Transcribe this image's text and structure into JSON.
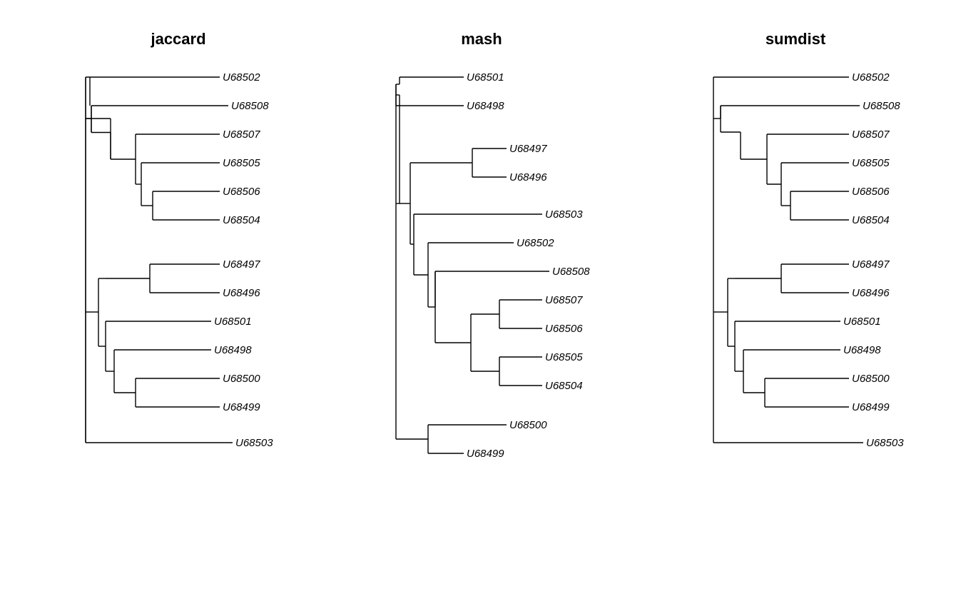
{
  "chart_data": [
    {
      "type": "dendrogram",
      "title": "jaccard",
      "tips": [
        "U68502",
        "U68508",
        "U68507",
        "U68505",
        "U68506",
        "U68504",
        "U68497",
        "U68496",
        "U68501",
        "U68498",
        "U68500",
        "U68499",
        "U68503"
      ],
      "clusters": [
        [
          "U68502"
        ],
        [
          "U68508",
          "U68507",
          "U68505",
          "U68506",
          "U68504"
        ],
        [
          "U68497",
          "U68496",
          "U68501",
          "U68498",
          "U68500",
          "U68499"
        ],
        [
          "U68503"
        ]
      ]
    },
    {
      "type": "dendrogram",
      "title": "mash",
      "tips": [
        "U68501",
        "U68498",
        "U68497",
        "U68496",
        "U68503",
        "U68502",
        "U68508",
        "U68507",
        "U68506",
        "U68505",
        "U68504",
        "U68500",
        "U68499"
      ],
      "clusters": [
        [
          "U68501",
          "U68498"
        ],
        [
          "U68497",
          "U68496"
        ],
        [
          "U68503",
          "U68502",
          "U68508",
          "U68507",
          "U68506",
          "U68505",
          "U68504"
        ],
        [
          "U68500",
          "U68499"
        ]
      ]
    },
    {
      "type": "dendrogram",
      "title": "sumdist",
      "tips": [
        "U68502",
        "U68508",
        "U68507",
        "U68505",
        "U68506",
        "U68504",
        "U68497",
        "U68496",
        "U68501",
        "U68498",
        "U68500",
        "U68499",
        "U68503"
      ],
      "clusters": [
        [
          "U68502"
        ],
        [
          "U68508",
          "U68507",
          "U68505",
          "U68506",
          "U68504"
        ],
        [
          "U68497",
          "U68496",
          "U68501",
          "U68498",
          "U68500",
          "U68499"
        ],
        [
          "U68503"
        ]
      ]
    }
  ],
  "titles": {
    "p0": "jaccard",
    "p1": "mash",
    "p2": "sumdist"
  },
  "labels": {
    "p0": [
      "U68502",
      "U68508",
      "U68507",
      "U68505",
      "U68506",
      "U68504",
      "U68497",
      "U68496",
      "U68501",
      "U68498",
      "U68500",
      "U68499",
      "U68503"
    ],
    "p1": [
      "U68501",
      "U68498",
      "U68497",
      "U68496",
      "U68503",
      "U68502",
      "U68508",
      "U68507",
      "U68506",
      "U68505",
      "U68504",
      "U68500",
      "U68499"
    ],
    "p2": [
      "U68502",
      "U68508",
      "U68507",
      "U68505",
      "U68506",
      "U68504",
      "U68497",
      "U68496",
      "U68501",
      "U68498",
      "U68500",
      "U68499",
      "U68503"
    ]
  }
}
